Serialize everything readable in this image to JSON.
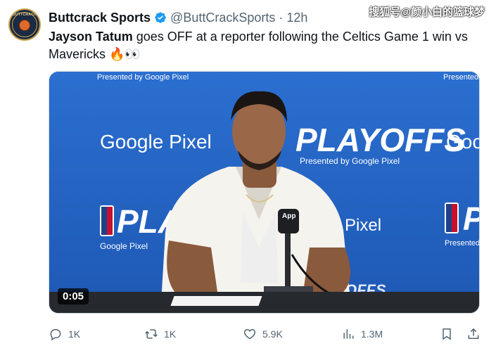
{
  "account": {
    "name": "Buttcrack Sports",
    "handle": "@ButtCrackSports",
    "separator": "·",
    "time": "12h",
    "avatar_text": "BUTTCRACK"
  },
  "watermark": "搜狐号@颜小白的篮球梦",
  "tweet": {
    "bold": "Jayson Tatum",
    "text": " goes OFF at a reporter following the Celtics Game 1 win vs Mavericks 🔥👀"
  },
  "media": {
    "duration": "0:05",
    "backdrop": {
      "google_pixel_1": "Google Pixel",
      "google_pixel_2": "Google Pixel",
      "google_pixel_partial": "Goo",
      "presented_1": "Presented by Google Pixel",
      "presented_2": "Presented by Google Pixel",
      "presented_3": "Presented by",
      "presented_4": "Presented by G",
      "playoffs_1": "PLAYOFFS",
      "playoffs_2": "PLAYOFFS",
      "playoffs_3": "P",
      "pixel_partial": "Pixel",
      "offs_partial": "OFFS",
      "mic_label": "App"
    }
  },
  "actions": {
    "reply_count": "1K",
    "retweet_count": "1K",
    "like_count": "5.9K",
    "view_count": "1.3M"
  },
  "colors": {
    "accent": "#1d9bf0",
    "muted": "#536471",
    "backdrop": "#2464c4"
  }
}
